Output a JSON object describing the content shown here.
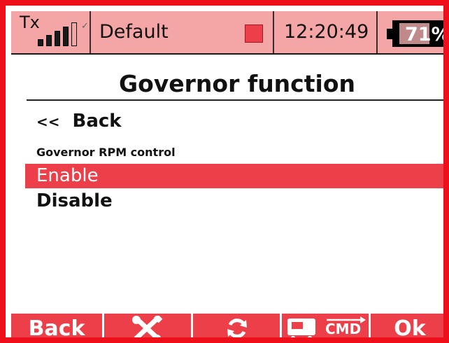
{
  "status_bar": {
    "tx_label": "Tx",
    "signal_level": 0.8,
    "profile_name": "Default",
    "clock": "12:20:49",
    "battery_percent": "71%",
    "battery_level": 0.71
  },
  "page": {
    "title": "Governor function"
  },
  "menu": {
    "back_arrows": "<<",
    "back_label": "Back",
    "section_label": "Governor RPM control",
    "options": [
      {
        "label": "Enable",
        "selected": true
      },
      {
        "label": "Disable",
        "selected": false
      }
    ]
  },
  "function_keys": {
    "f1_label": "Back",
    "f2_icon": "wrench-screwdriver-icon",
    "f3_icon": "refresh-icon",
    "f4_icon": "transmitter-cmd-icon",
    "f4_text": "CMD",
    "f5_label": "Ok"
  },
  "colors": {
    "frame": "#ee0f1a",
    "accent": "#ec3f49",
    "status_bg": "#f4a5a5"
  }
}
